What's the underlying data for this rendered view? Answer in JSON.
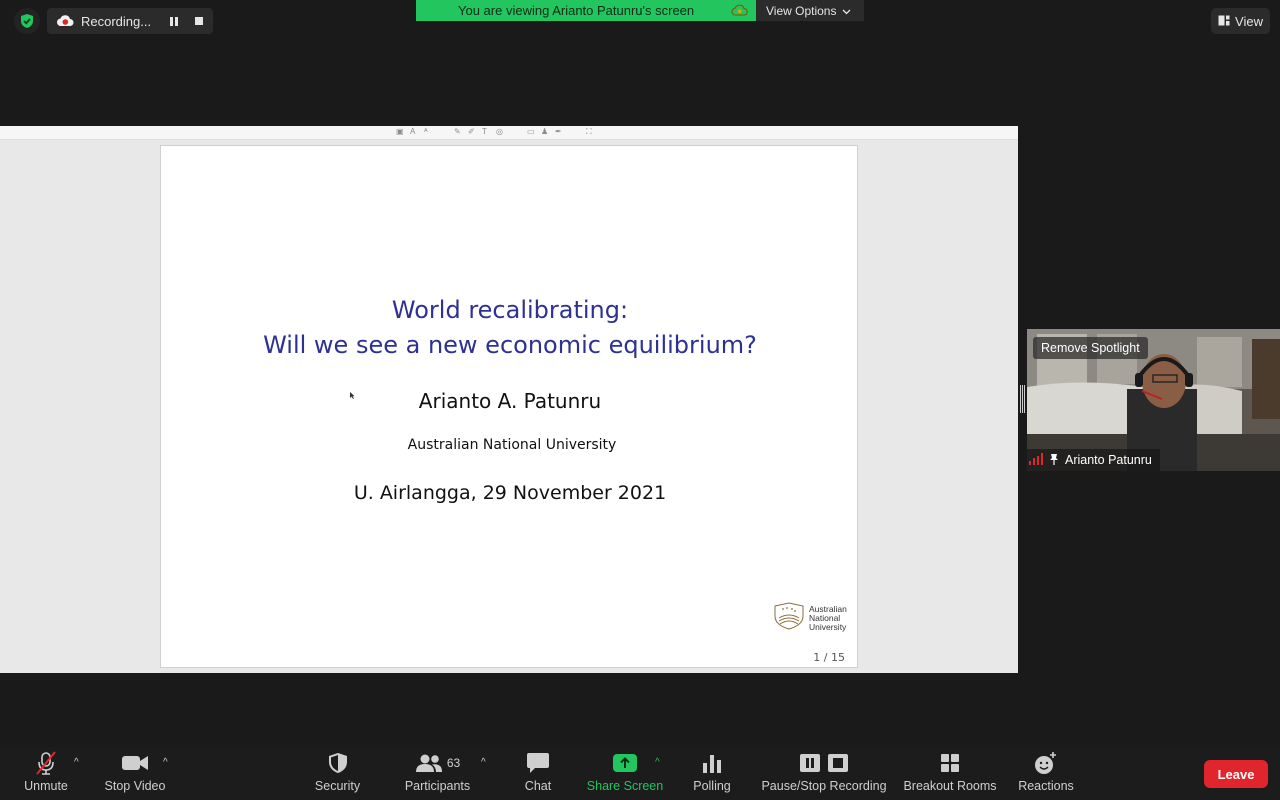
{
  "top": {
    "recording_label": "Recording...",
    "viewing_banner": "You are viewing Arianto Patunru's screen",
    "view_options_label": "View Options",
    "view_label": "View"
  },
  "slide": {
    "title_line1": "World recalibrating:",
    "title_line2": "Will we see a new economic equilibrium?",
    "author": "Arianto A. Patunru",
    "institution": "Australian National University",
    "event": "U. Airlangga, 29 November 2021",
    "logo_line1": "Australian",
    "logo_line2": "National",
    "logo_line3": "University",
    "page": "1 / 15",
    "title_color": "#2e3192"
  },
  "video": {
    "remove_spotlight": "Remove Spotlight",
    "participant_name": "Arianto Patunru"
  },
  "toolbar": {
    "unmute": "Unmute",
    "stop_video": "Stop Video",
    "security": "Security",
    "participants": "Participants",
    "participants_count": "63",
    "chat": "Chat",
    "share_screen": "Share Screen",
    "polling": "Polling",
    "pause_stop_recording": "Pause/Stop Recording",
    "breakout_rooms": "Breakout Rooms",
    "reactions": "Reactions",
    "leave": "Leave",
    "accent_green": "#22c55e",
    "leave_red": "#e0262c"
  }
}
